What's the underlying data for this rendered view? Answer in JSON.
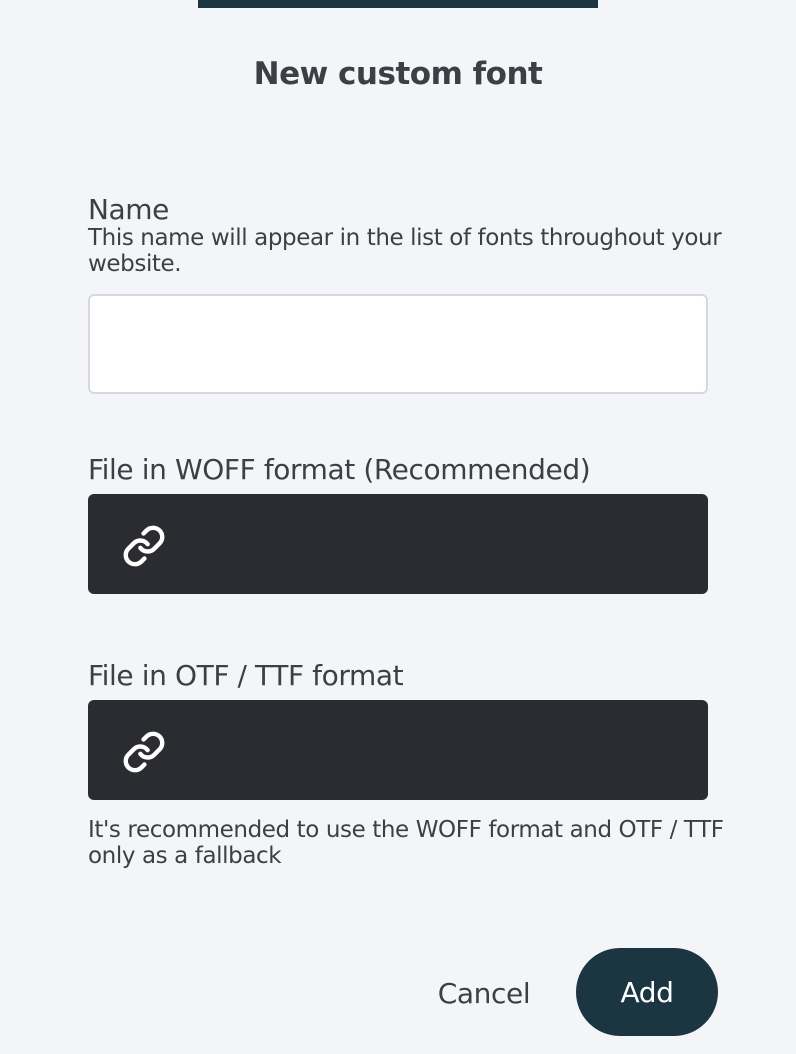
{
  "dialog": {
    "title": "New custom font"
  },
  "fields": {
    "name": {
      "label": "Name",
      "help": "This name will appear in the list of fonts throughout your website.",
      "value": "",
      "placeholder": ""
    },
    "woff": {
      "label": "File in WOFF format (Recommended)",
      "icon": "link-icon"
    },
    "otf": {
      "label": "File in OTF / TTF format",
      "icon": "link-icon"
    },
    "format_help": "It's recommended to use the WOFF format and OTF / TTF only as a fallback"
  },
  "actions": {
    "cancel_label": "Cancel",
    "add_label": "Add"
  },
  "colors": {
    "background": "#f4f5f9",
    "primary": "#1b3541",
    "file_field": "#2a2c31",
    "text": "#3d3f44"
  }
}
